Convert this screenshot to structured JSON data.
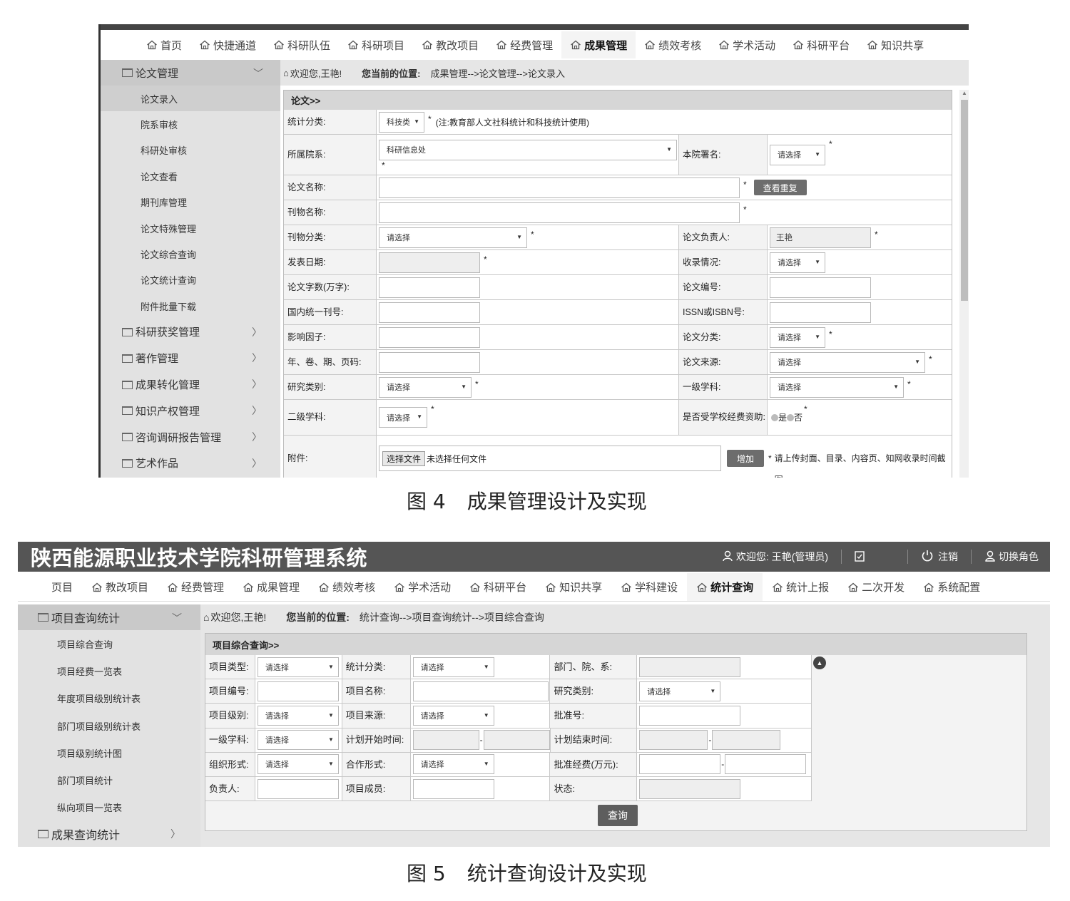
{
  "figure4": {
    "nav": [
      "首页",
      "快捷通道",
      "科研队伍",
      "科研项目",
      "教改项目",
      "经费管理",
      "成果管理",
      "绩效考核",
      "学术活动",
      "科研平台",
      "知识共享"
    ],
    "nav_active_index": 6,
    "sidebar": {
      "open_group": "论文管理",
      "sub_items": [
        "论文录入",
        "院系审核",
        "科研处审核",
        "论文查看",
        "期刊库管理",
        "论文特殊管理",
        "论文综合查询",
        "论文统计查询",
        "附件批量下载"
      ],
      "active_sub": 0,
      "groups": [
        "科研获奖管理",
        "著作管理",
        "成果转化管理",
        "知识产权管理",
        "咨询调研报告管理",
        "艺术作品"
      ]
    },
    "breadcrumb": {
      "welcome": "欢迎您,王艳!",
      "position_label": "您当前的位置:",
      "path": "成果管理-->论文管理-->论文录入"
    },
    "form_title": "论文>>",
    "fields": {
      "stat_category_label": "统计分类:",
      "stat_category_value": "科技类",
      "stat_category_note": "(注:教育部人文社科统计和科技统计使用)",
      "dept_label": "所属院系:",
      "dept_value": "科研信息处",
      "signature_label": "本院署名:",
      "paper_name_label": "论文名称:",
      "check_dup_button": "查看重复",
      "journal_name_label": "刊物名称:",
      "journal_type_label": "刊物分类:",
      "owner_label": "论文负责人:",
      "owner_value": "王艳",
      "pub_date_label": "发表日期:",
      "indexed_label": "收录情况:",
      "word_count_label": "论文字数(万字):",
      "paper_no_label": "论文编号:",
      "cn_label": "国内统一刊号:",
      "issn_label": "ISSN或ISBN号:",
      "impact_label": "影响因子:",
      "paper_class_label": "论文分类:",
      "volume_label": "年、卷、期、页码:",
      "source_label": "论文来源:",
      "research_type_label": "研究类别:",
      "subject1_label": "一级学科:",
      "subject2_label": "二级学科:",
      "funded_label": "是否受学校经费资助:",
      "radio_yes": "是",
      "radio_no": "否",
      "attach_label": "附件:",
      "choose_file": "选择文件",
      "no_file": "未选择任何文件",
      "add_button": "增加",
      "attach_note": "请上传封面、目录、内容页、知网收录时间截图。",
      "placeholder_select": "请选择",
      "required_mark": "*"
    },
    "caption_num": "图 4",
    "caption_text": "成果管理设计及实现"
  },
  "figure5": {
    "app_title": "陕西能源职业技术学院科研管理系统",
    "header_user": "欢迎您: 王艳(管理员)",
    "header_logout": "注销",
    "header_switch": "切换角色",
    "nav": [
      "页目",
      "教改项目",
      "经费管理",
      "成果管理",
      "绩效考核",
      "学术活动",
      "科研平台",
      "知识共享",
      "学科建设",
      "统计查询",
      "统计上报",
      "二次开发",
      "系统配置"
    ],
    "nav_active_index": 9,
    "sidebar": {
      "open_group": "项目查询统计",
      "sub_items": [
        "项目综合查询",
        "项目经费一览表",
        "年度项目级别统计表",
        "部门项目级别统计表",
        "项目级别统计图",
        "部门项目统计",
        "纵向项目一览表"
      ],
      "closed_group": "成果查询统计"
    },
    "breadcrumb": {
      "welcome": "欢迎您,王艳!",
      "position_label": "您当前的位置:",
      "path": "统计查询-->项目查询统计-->项目综合查询"
    },
    "form_title": "项目综合查询>>",
    "labels": {
      "project_type": "项目类型:",
      "stat_category": "统计分类:",
      "dept": "部门、院、系:",
      "project_no": "项目编号:",
      "project_name": "项目名称:",
      "research_type": "研究类别:",
      "project_level": "项目级别:",
      "project_source": "项目来源:",
      "approval_no": "批准号:",
      "subject1": "一级学科:",
      "plan_start": "计划开始时间:",
      "plan_end": "计划结束时间:",
      "org_form": "组织形式:",
      "coop_form": "合作形式:",
      "approved_funds": "批准经费(万元):",
      "owner": "负责人:",
      "members": "项目成员:",
      "status": "状态:"
    },
    "placeholder_select": "请选择",
    "query_button": "查询",
    "caption_num": "图 5",
    "caption_text": "统计查询设计及实现"
  }
}
